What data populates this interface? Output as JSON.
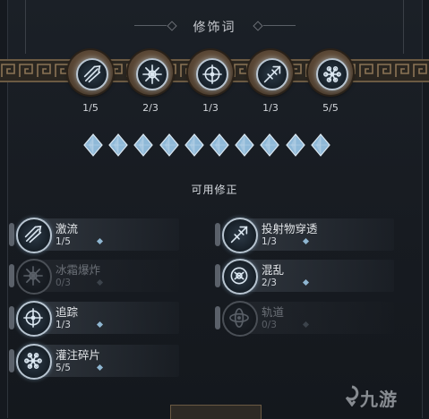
{
  "header": {
    "title": "修饰词"
  },
  "slots": [
    {
      "icon": "stream-slash-icon",
      "ratio": "1/5"
    },
    {
      "icon": "frost-burst-icon",
      "ratio": "2/3"
    },
    {
      "icon": "tracking-compass-icon",
      "ratio": "1/3"
    },
    {
      "icon": "projectile-pierce-icon",
      "ratio": "1/3"
    },
    {
      "icon": "infused-shard-icon",
      "ratio": "5/5"
    }
  ],
  "gems": {
    "total": 10,
    "filled": 10,
    "color": "#8fb9d8"
  },
  "available_section": {
    "title": "可用修正"
  },
  "modifiers": [
    {
      "name": "激流",
      "count": "1/5",
      "icon": "stream-slash-icon",
      "active": true
    },
    {
      "name": "投射物穿透",
      "count": "1/3",
      "icon": "projectile-pierce-icon",
      "active": true
    },
    {
      "name": "冰霜爆炸",
      "count": "0/3",
      "icon": "frost-burst-icon",
      "active": false
    },
    {
      "name": "混乱",
      "count": "2/3",
      "icon": "chaos-icon",
      "active": true
    },
    {
      "name": "追踪",
      "count": "1/3",
      "icon": "tracking-compass-icon",
      "active": true
    },
    {
      "name": "轨道",
      "count": "0/3",
      "icon": "orbit-icon",
      "active": false
    },
    {
      "name": "灌注碎片",
      "count": "5/5",
      "icon": "infused-shard-icon",
      "active": true
    }
  ],
  "colors": {
    "accent": "#b8c5d1",
    "gem": "#8fb9d8",
    "bronze": "#6b5a43"
  },
  "watermark": {
    "text": "九游"
  }
}
